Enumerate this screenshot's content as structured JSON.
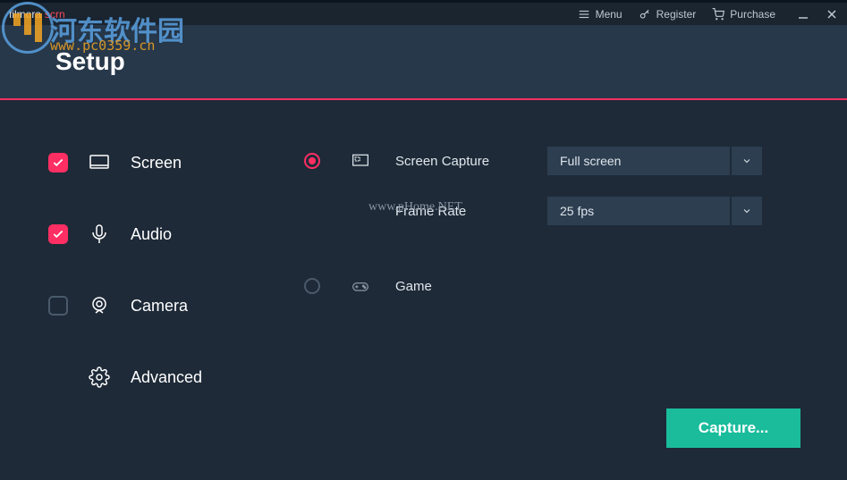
{
  "titlebar": {
    "logo_main": "filmora",
    "logo_accent": "scrn",
    "menu_label": "Menu",
    "register_label": "Register",
    "purchase_label": "Purchase"
  },
  "header": {
    "title": "Setup"
  },
  "sidebar": {
    "items": [
      {
        "label": "Screen",
        "checked": true
      },
      {
        "label": "Audio",
        "checked": true
      },
      {
        "label": "Camera",
        "checked": false
      },
      {
        "label": "Advanced",
        "checked": null
      }
    ]
  },
  "content": {
    "screen_capture": {
      "label": "Screen Capture",
      "value": "Full screen"
    },
    "frame_rate": {
      "label": "Frame Rate",
      "value": "25 fps"
    },
    "game": {
      "label": "Game"
    },
    "watermark": "www.pHome.NET"
  },
  "actions": {
    "capture": "Capture..."
  },
  "overlay": {
    "text": "河东软件园",
    "url": "www.pc0359.cn"
  }
}
